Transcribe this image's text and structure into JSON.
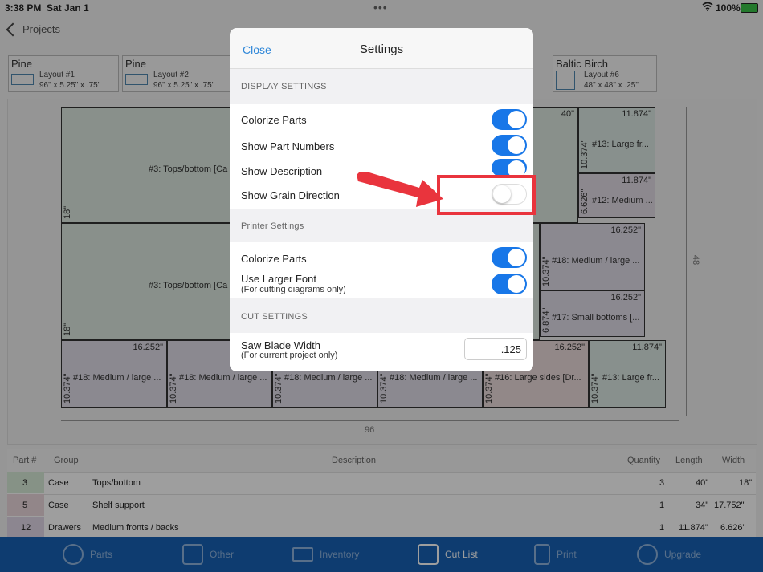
{
  "status_bar": {
    "time": "3:38 PM",
    "date": "Sat Jan 1",
    "battery": "100%"
  },
  "nav": {
    "back_label": "Projects"
  },
  "layouts": [
    {
      "material": "Pine",
      "name": "Layout #1",
      "size": "96\" x 5.25\" x .75\""
    },
    {
      "material": "Pine",
      "name": "Layout #2",
      "size": "96\" x 5.25\" x .75\""
    },
    {
      "material": "Baltic Birch",
      "name": "Layout #6",
      "size": "48\" x 48\" x .25\""
    }
  ],
  "diagram": {
    "dim_bottom": "96",
    "dim_right": "48",
    "parts": [
      {
        "label": "#3: Tops/bottom [Ca",
        "width": "40\"",
        "length": "18\""
      },
      {
        "label": "#3: Tops/bottom [Ca",
        "length": "18\""
      },
      {
        "label": "#13: Large fr...",
        "width": "11.874\"",
        "length": "10.374\""
      },
      {
        "label": "#12: Medium ...",
        "width": "11.874\"",
        "length": "6.626\""
      },
      {
        "label": "#18: Medium / large ...",
        "width": "16.252\"",
        "length": "10.374\""
      },
      {
        "label": "#17: Small bottoms [...",
        "width": "16.252\"",
        "length": "6.874\""
      },
      {
        "label": "#18: Medium / large ...",
        "width": "16.252\"",
        "length": "10.374\""
      },
      {
        "label": "#18: Medium / large ...",
        "length": "10.374\""
      },
      {
        "label": "#18: Medium / large ...",
        "length": "10.374\""
      },
      {
        "label": "#18: Medium / large ...",
        "length": "10.374\""
      },
      {
        "label": "#16: Large sides [Dr...",
        "width": "16.252\"",
        "length": "10.374\""
      },
      {
        "label": "#13: Large fr...",
        "width": "11.874\"",
        "length": "10.374\""
      }
    ]
  },
  "table": {
    "headers": [
      "Part #",
      "Group",
      "Description",
      "Quantity",
      "Length",
      "Width"
    ],
    "rows": [
      {
        "part": "3",
        "group": "Case",
        "description": "Tops/bottom",
        "quantity": "3",
        "length": "40\"",
        "width": "18\"",
        "color": "#d8ecd8"
      },
      {
        "part": "5",
        "group": "Case",
        "description": "Shelf support",
        "quantity": "1",
        "length": "34\"",
        "width": "17.752\"",
        "color": "#ecd8de"
      },
      {
        "part": "12",
        "group": "Drawers",
        "description": "Medium fronts / backs",
        "quantity": "1",
        "length": "11.874\"",
        "width": "6.626\"",
        "color": "#e2d8e8"
      }
    ]
  },
  "tabs": [
    {
      "label": "Parts",
      "icon": "tape-measure-icon"
    },
    {
      "label": "Other",
      "icon": "pencil-square-icon"
    },
    {
      "label": "Inventory",
      "icon": "stack-icon"
    },
    {
      "label": "Cut List",
      "icon": "cut-list-icon"
    },
    {
      "label": "Print",
      "icon": "document-icon"
    },
    {
      "label": "Upgrade",
      "icon": "upgrade-arrow-icon"
    }
  ],
  "settings": {
    "close_label": "Close",
    "title": "Settings",
    "display_header": "DISPLAY SETTINGS",
    "display": [
      {
        "label": "Colorize Parts",
        "on": true
      },
      {
        "label": "Show Part Numbers",
        "on": true
      },
      {
        "label": "Show Description",
        "on": true
      },
      {
        "label": "Show Grain Direction",
        "on": false
      }
    ],
    "printer_header": "Printer Settings",
    "printer": [
      {
        "label": "Colorize Parts",
        "on": true
      },
      {
        "label": "Use Larger Font",
        "sub": "(For cutting diagrams only)",
        "on": true
      }
    ],
    "cut_header": "CUT SETTINGS",
    "cut": {
      "label": "Saw Blade Width",
      "sub": "(For current project only)",
      "value": ".125"
    }
  },
  "colors": {
    "accent": "#1877e8",
    "tabbar": "#1762b5",
    "highlight": "#e9343d",
    "link": "#2d86d8"
  }
}
